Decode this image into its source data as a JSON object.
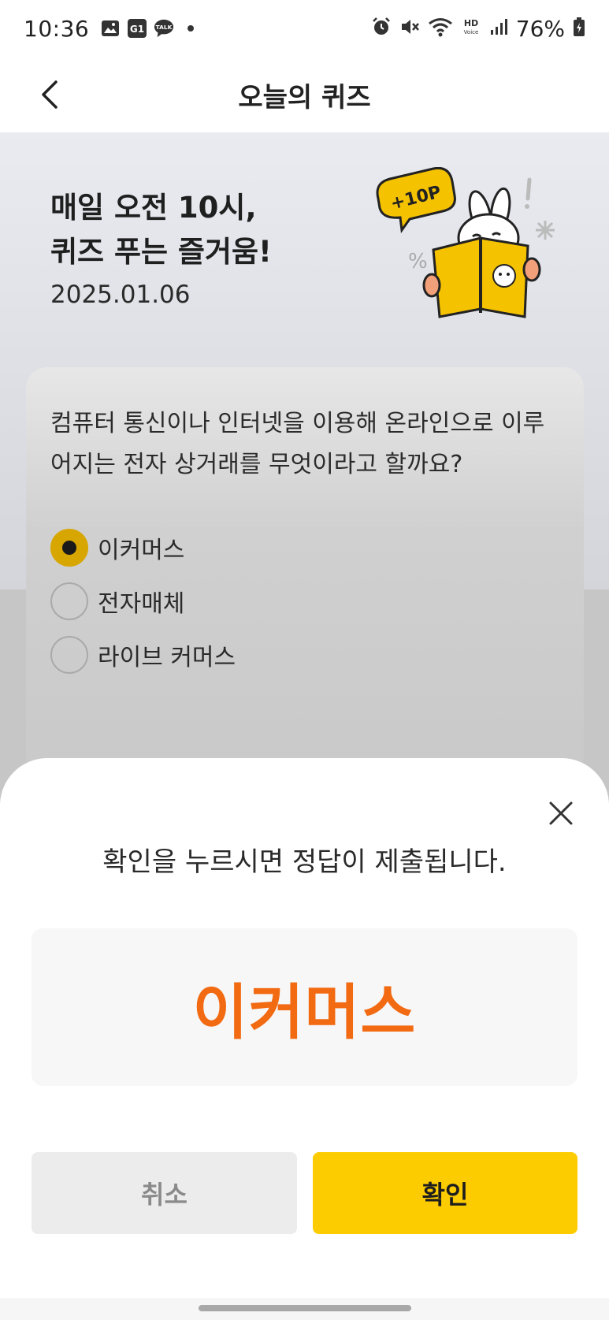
{
  "status_bar": {
    "time": "10:36",
    "notification_icons": [
      "image-icon",
      "g1-app-icon",
      "kakaotalk-icon",
      "dot-icon"
    ],
    "kakaotalk_text": "TALK",
    "g1_text": "G1",
    "hd_text": "HD",
    "voice_text": "Voice",
    "battery_percent": "76%"
  },
  "header": {
    "title": "오늘의 퀴즈"
  },
  "hero": {
    "title": "매일 오전 10시,\n퀴즈 푸는 즐거움!",
    "date": "2025.01.06",
    "badge": "+10P"
  },
  "quiz": {
    "question": "컴퓨터 통신이나 인터넷을 이용해 온라인으로 이루어지는 전자 상거래를 무엇이라고 할까요?",
    "options": [
      {
        "label": "이커머스",
        "selected": true
      },
      {
        "label": "전자매체",
        "selected": false
      },
      {
        "label": "라이브 커머스",
        "selected": false
      }
    ]
  },
  "sheet": {
    "message": "확인을 누르시면 정답이 제출됩니다.",
    "selected_answer": "이커머스",
    "cancel_label": "취소",
    "confirm_label": "확인"
  },
  "colors": {
    "accent_yellow": "#fdcc00",
    "answer_orange": "#f26a12",
    "radio_selected": "#d7a600"
  }
}
